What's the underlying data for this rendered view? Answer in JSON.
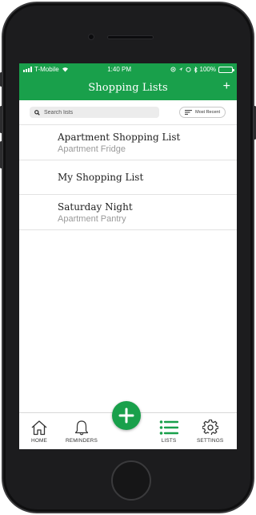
{
  "status_bar": {
    "carrier": "T-Mobile",
    "time": "1:40 PM",
    "battery_percent": "100%",
    "battery_level": 1.0
  },
  "header": {
    "title": "Shopping Lists",
    "add_label": "+"
  },
  "search": {
    "placeholder": "Search lists"
  },
  "sort": {
    "label": "Most Recent"
  },
  "lists": [
    {
      "name": "Apartment Shopping List",
      "subtitle": "Apartment Fridge"
    },
    {
      "name": "My Shopping List",
      "subtitle": ""
    },
    {
      "name": "Saturday Night",
      "subtitle": "Apartment Pantry"
    }
  ],
  "tabs": {
    "home": "HOME",
    "reminders": "REMINDERS",
    "lists": "LISTS",
    "settings": "SETTINGS"
  },
  "icons": {
    "wifi": "wifi-icon",
    "signal": "signal-icon",
    "battery": "battery-icon",
    "search": "search-icon",
    "sort": "sort-lines-icon",
    "chevron": "chevron-right-icon",
    "home": "home-icon",
    "reminders": "bell-icon",
    "add": "plus-icon",
    "lists": "list-icon",
    "settings": "gear-icon"
  },
  "colors": {
    "brand_green": "#19a04b",
    "text_dark": "#222222",
    "text_muted": "#9a9a9a",
    "divider": "#e2e2e2"
  }
}
